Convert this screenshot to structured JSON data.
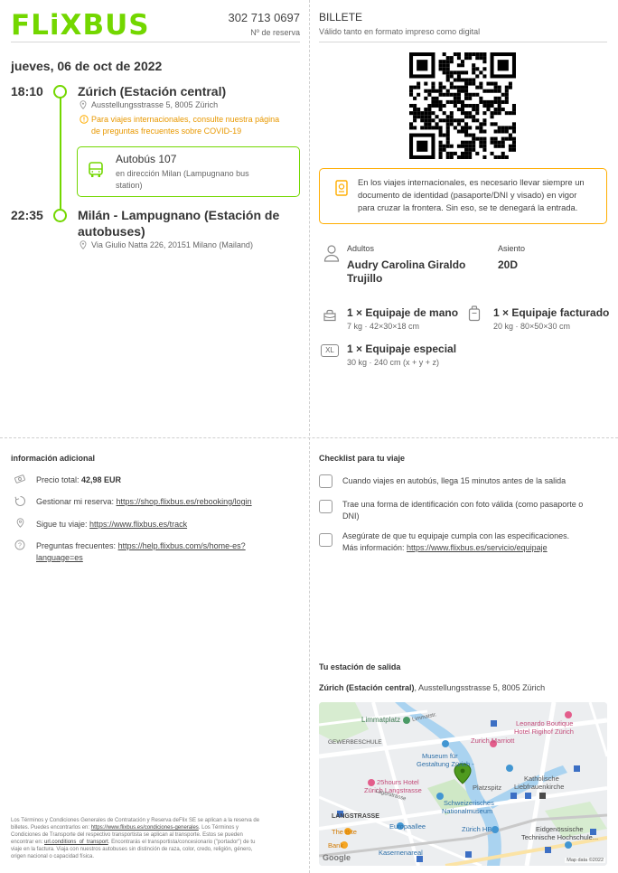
{
  "header": {
    "logo_text": "FLiXBUS",
    "booking_number": "302 713 0697",
    "booking_label": "Nº de reserva"
  },
  "ticket": {
    "title": "BILLETE",
    "subtitle": "Válido tanto en formato impreso como digital"
  },
  "trip": {
    "date": "jueves, 06 de oct de 2022",
    "departure": {
      "time": "18:10",
      "station": "Zúrich (Estación central)",
      "address": "Ausstellungsstrasse 5, 8005 Zürich",
      "notice_line1": "Para viajes internacionales, consulte nuestra página",
      "notice_line2": "de preguntas frecuentes sobre COVID-19"
    },
    "bus": {
      "name": "Autobús 107",
      "direction_line1": "en dirección Milan (Lampugnano bus",
      "direction_line2": "station)"
    },
    "arrival": {
      "time": "22:35",
      "station_line1": "Milán - Lampugnano (Estación de",
      "station_line2": "autobuses)",
      "address": "Via Giulio Natta 226, 20151 Milano (Mailand)"
    }
  },
  "id_warning": {
    "line1": "En los viajes internacionales, es necesario llevar siempre un",
    "line2": "documento de identidad (pasaporte/DNI y visado) en vigor",
    "line3": "para cruzar la frontera. Sin eso, se te denegará la entrada."
  },
  "passenger": {
    "adults_label": "Adultos",
    "name_line1": "Audry Carolina Giraldo",
    "name_line2": "Trujillo",
    "seat_label": "Asiento",
    "seat": "20D"
  },
  "luggage": {
    "hand_title": "1 × Equipaje de mano",
    "hand_spec": "7 kg · 42×30×18 cm",
    "checked_title": "1 × Equipaje facturado",
    "checked_spec": "20 kg · 80×50×30 cm",
    "special_title": "1 × Equipaje especial",
    "special_spec": "30 kg · 240 cm (x + y + z)",
    "xl_badge": "XL"
  },
  "additional": {
    "heading": "información adicional",
    "price_label": "Precio total: ",
    "price_value": "42,98 EUR",
    "manage_label": "Gestionar mi reserva: ",
    "manage_link": "https://shop.flixbus.es/rebooking/login",
    "track_label": "Sigue tu viaje: ",
    "track_link": "https://www.flixbus.es/track",
    "faq_label": "Preguntas frecuentes: ",
    "faq_link_line1": "https://help.flixbus.com/s/home-es?",
    "faq_link_line2": "language=es"
  },
  "checklist": {
    "heading": "Checklist para tu viaje",
    "item1": "Cuando viajes en autobús, llega 15 minutos antes de la salida",
    "item2_line1": "Trae una forma de identificación con foto válida (como pasaporte o",
    "item2_line2": "DNI)",
    "item3_line1": "Asegúrate de que tu equipaje cumpla con las especificaciones.",
    "item3_label": "Más información: ",
    "item3_link": "https://www.flixbus.es/servicio/equipaje"
  },
  "station": {
    "heading": "Tu estación de salida",
    "name": "Zúrich (Estación central)",
    "address": ", Ausstellungsstrasse 5, 8005 Zürich"
  },
  "map": {
    "labels": {
      "limmatplatz": "Limmatplatz",
      "gewerbeschule": "GEWERBESCHULE",
      "museum1": "Museum für",
      "museum2": "Gestaltung Zürich -",
      "marriott": "Zurich Marriott",
      "leonardo1": "Leonardo Boutique",
      "leonardo2": "Hotel Rigihof Zürich",
      "hours1": "25hours Hotel",
      "hours2": "Zürich Langstrasse",
      "platzspitz": "Platzspitz",
      "katholische1": "Katholische",
      "katholische2": "Liebfrauenkirche",
      "landes1": "Schweizerisches",
      "landes2": "Nationalmuseum",
      "langstrasse": "LANGSTRASSE",
      "europaallee": "Europaallee",
      "zurichhb": "Zürich HB",
      "eth1": "Eidgenössische",
      "eth2": "Technische Hochschule...",
      "bite": "The Bite",
      "bank": "Bank",
      "kasernenareal": "Kasernenareal",
      "google": "Google",
      "mapdata": "Map data ©2022",
      "lagerstrasse": "Lagerstrasse",
      "limmatstrasse": "Limmatstr."
    }
  },
  "legal": {
    "line1": "Los Términos y Condiciones Generales de Contratación y Reserva deFlix SE se aplican a la reserva de",
    "line2a": "billetes. Puedes encontrarlos en: ",
    "line2_link": "https://www.flixbus.es/condiciones-generales",
    "line2b": ". Los Términos y",
    "line3": "Condiciones de Transporte del respectivo transportista se aplican al transporte. Estos se pueden",
    "line4a": "encontrar en: ",
    "line4_link": "url.conditions_of_transport",
    "line4b": ". Encontrarás el transportista/concesionario (\"portador\") de tu",
    "line5": "viaje en la factura. Viaja con nuestros autobuses sin distinción de raza, color, credo, religión, género,",
    "line6": "origen nacional o capacidad física."
  },
  "colors": {
    "brand_green": "#73d700",
    "warning_orange": "#ffad00",
    "text": "#444444"
  }
}
